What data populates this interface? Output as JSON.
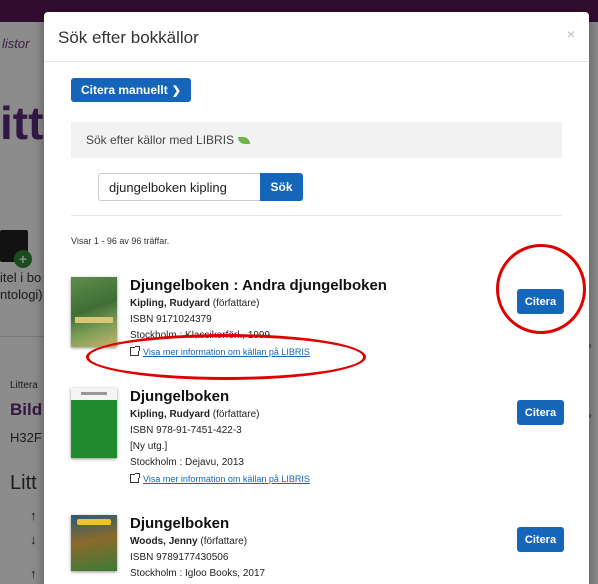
{
  "background": {
    "breadcrumb": "listor",
    "heading": "itte",
    "left_text_1": "itel i bo",
    "left_text_2": "ntologi)",
    "left_text_3": "Littera",
    "left_text_4": "Bild",
    "left_text_5": "H32F",
    "left_text_6": "Litt",
    "arrow_up_1": "↑",
    "arrow_down": "↓",
    "arrow_up_2": "↑"
  },
  "modal": {
    "title": "Sök efter bokkällor",
    "close": "×",
    "manual_cite_label": "Citera manuellt",
    "libris_heading": "Sök efter källor med LIBRIS",
    "search_value": "djungelboken kipling",
    "search_button": "Sök",
    "hits_text": "Visar 1 - 96 av 96 träffar."
  },
  "results": [
    {
      "title": "Djungelboken : Andra djungelboken",
      "author": "Kipling, Rudyard",
      "role": "(författare)",
      "isbn": "ISBN 9171024379",
      "publisher": "Stockholm : Klassikerförl., 1999",
      "link": "Visa mer information om källan på LIBRIS",
      "cite": "Citera"
    },
    {
      "title": "Djungelboken",
      "author": "Kipling, Rudyard",
      "role": "(författare)",
      "isbn": "ISBN 978-91-7451-422-3",
      "edition": "[Ny utg.]",
      "publisher": "Stockholm : Dejavu, 2013",
      "link": "Visa mer information om källan på LIBRIS",
      "cite": "Citera"
    },
    {
      "title": "Djungelboken",
      "author": "Woods, Jenny",
      "role": "(författare)",
      "isbn": "ISBN 9789177430506",
      "publisher": "Stockholm : Igloo Books, 2017",
      "cite": "Citera"
    }
  ],
  "colors": {
    "primary": "#1565b8",
    "annotation": "#e00000",
    "topbar": "#5a1a56"
  }
}
